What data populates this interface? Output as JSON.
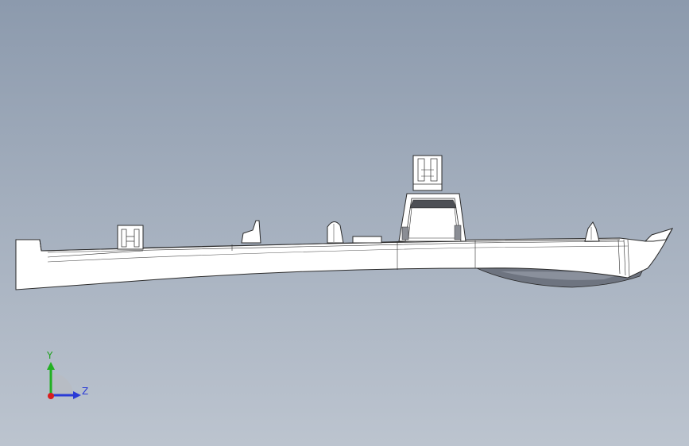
{
  "viewport": {
    "background_top": "#8c9aad",
    "background_bottom": "#bcc4cf",
    "model_fill": "#ffffff",
    "model_edge": "#2b2b2b",
    "shadow_fill": "#6e7480"
  },
  "triad": {
    "y_label": "Y",
    "z_label": "Z",
    "y_color": "#22b022",
    "z_color": "#2a3bd6",
    "x_color": "#d81e1e"
  }
}
